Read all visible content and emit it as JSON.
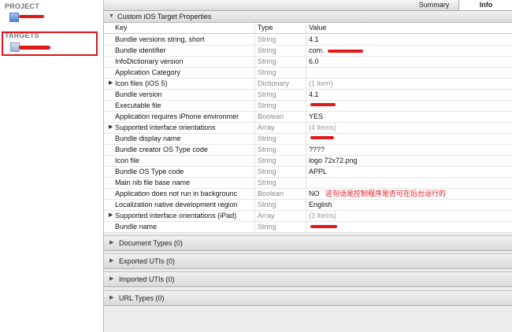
{
  "sidebar": {
    "project_header": "PROJECT",
    "targets_header": "TARGETS"
  },
  "tabs": {
    "summary": "Summary",
    "info": "Info"
  },
  "properties_section": {
    "title": "Custom iOS Target Properties",
    "columns": {
      "key": "Key",
      "type": "Type",
      "value": "Value"
    },
    "rows": [
      {
        "key": "Bundle versions string, short",
        "type": "String",
        "value": "4.1"
      },
      {
        "key": "Bundle identifier",
        "type": "String",
        "value": "com."
      },
      {
        "key": "InfoDictionary version",
        "type": "String",
        "value": "6.0"
      },
      {
        "key": "Application Category",
        "type": "String",
        "value": ""
      },
      {
        "key": "Icon files (iOS 5)",
        "type": "Dictionary",
        "value": "(1 item)"
      },
      {
        "key": "Bundle version",
        "type": "String",
        "value": "4.1"
      },
      {
        "key": "Executable file",
        "type": "String",
        "value": ""
      },
      {
        "key": "Application requires iPhone environmer",
        "type": "Boolean",
        "value": "YES"
      },
      {
        "key": "Supported interface orientations",
        "type": "Array",
        "value": "(4 items)"
      },
      {
        "key": "Bundle display name",
        "type": "String",
        "value": ""
      },
      {
        "key": "Bundle creator OS Type code",
        "type": "String",
        "value": "????"
      },
      {
        "key": "Icon file",
        "type": "String",
        "value": "logo 72x72.png"
      },
      {
        "key": "Bundle OS Type code",
        "type": "String",
        "value": "APPL"
      },
      {
        "key": "Main nib file base name",
        "type": "String",
        "value": ""
      },
      {
        "key": "Application does not run in backgrounc",
        "type": "Boolean",
        "value": "NO"
      },
      {
        "key": "Localization native development region",
        "type": "String",
        "value": "English"
      },
      {
        "key": "Supported interface orientations (iPad)",
        "type": "Array",
        "value": "(3 items)"
      },
      {
        "key": "Bundle name",
        "type": "String",
        "value": ""
      }
    ],
    "annotation": "这句话是控制程序是否可在后台运行的"
  },
  "collapsed_sections": [
    {
      "title": "Document Types (0)"
    },
    {
      "title": "Exported UTIs (0)"
    },
    {
      "title": "Imported UTIs (0)"
    },
    {
      "title": "URL Types (0)"
    }
  ],
  "colors": {
    "annotation_red": "#e4171f",
    "redaction_red": "#e01818",
    "type_gray": "#8a8a8a"
  },
  "icons": {
    "disclosure_open": "triangle-down-icon",
    "disclosure_closed": "triangle-right-icon",
    "project": "project-file-icon",
    "target": "target-app-icon"
  }
}
